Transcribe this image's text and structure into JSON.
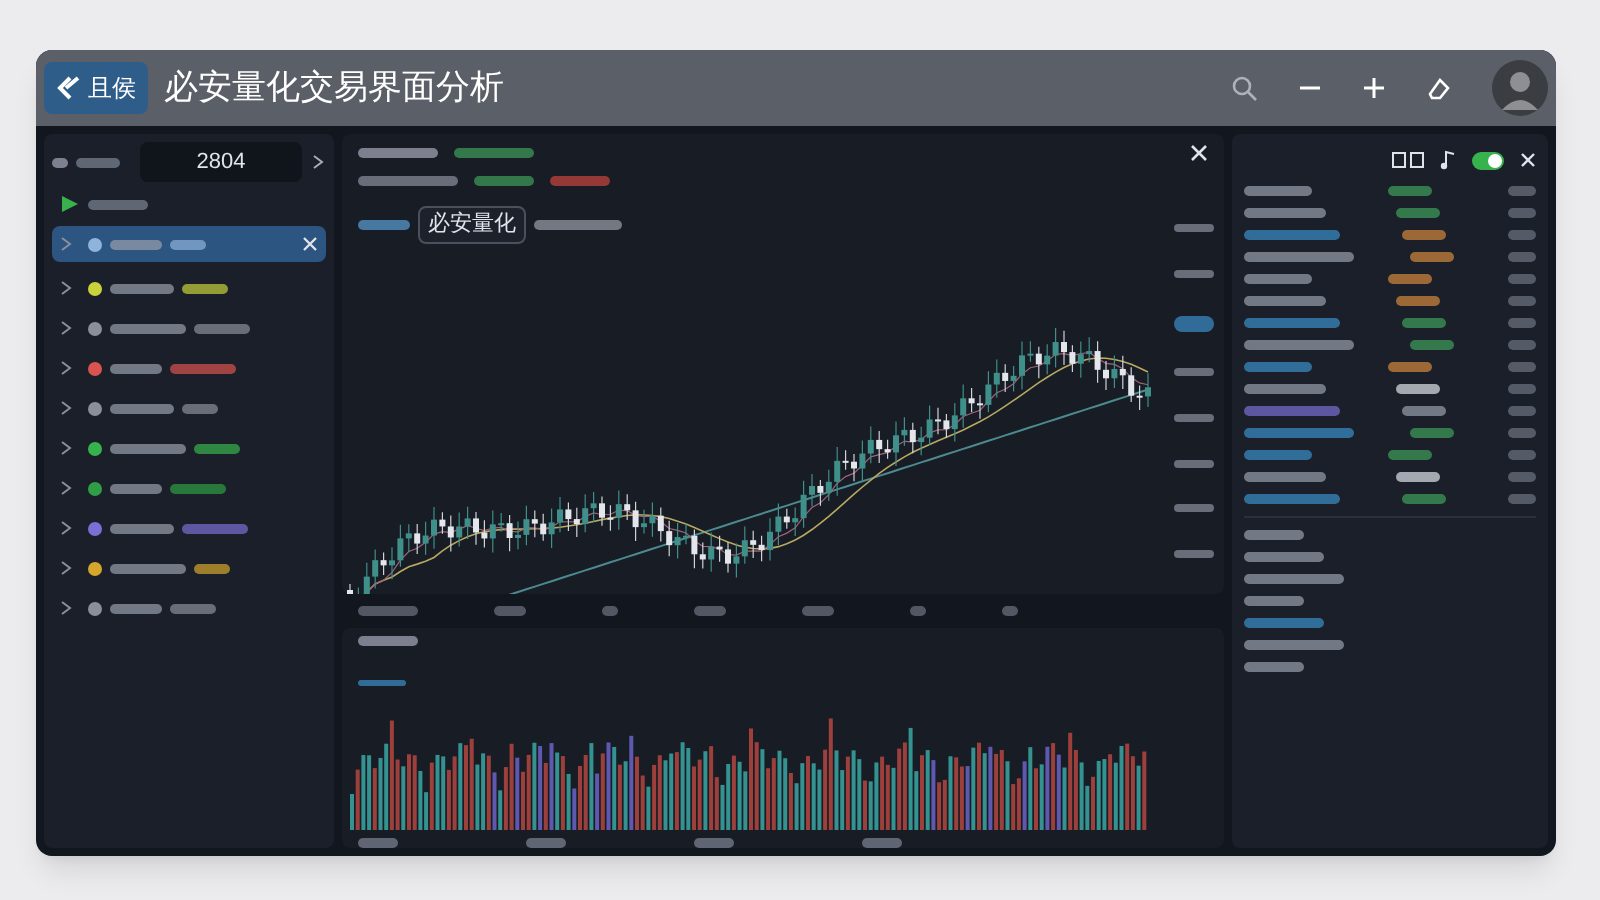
{
  "window": {
    "logo": "且侯",
    "title": "必安量化交易界面分析"
  },
  "sidebar": {
    "search_value": "2804",
    "items": [
      {
        "selected": true,
        "color": "#8fb4dc"
      },
      {
        "selected": false,
        "color": "#c9d23a"
      },
      {
        "selected": false,
        "color": "#8a8f99"
      },
      {
        "selected": false,
        "color": "#d9534f"
      },
      {
        "selected": false,
        "color": "#8a8f99"
      },
      {
        "selected": false,
        "color": "#37b24d"
      },
      {
        "selected": false,
        "color": "#2f9e44"
      },
      {
        "selected": false,
        "color": "#7b6fd6"
      },
      {
        "selected": false,
        "color": "#d4a72c"
      },
      {
        "selected": false,
        "color": "#8a8f99"
      }
    ]
  },
  "chart": {
    "tag": "必安量化"
  },
  "right_panel": {
    "toggle_on": true
  }
}
